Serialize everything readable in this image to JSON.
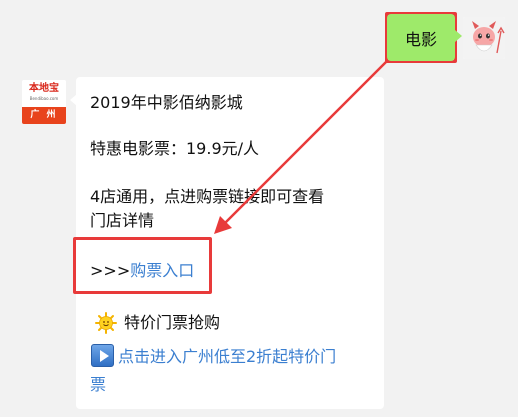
{
  "outgoing": {
    "text": "电影"
  },
  "brand_avatar": {
    "name": "本地宝",
    "sub": "Bendibao.com",
    "city": "广 州"
  },
  "incoming": {
    "line1": "2019年中影佰纳影城",
    "line2": "特惠电影票：19.9元/人",
    "line3": "4店通用，点进购票链接即可查看",
    "line4": "门店详情",
    "link_prefix": ">>>",
    "link_text": "购票入口",
    "promo_title": "特价门票抢购",
    "promo_link_1": "点击进入广州低至2折起特价门",
    "promo_link_2": "票"
  },
  "icons": {
    "sun": "sun-emoji-icon",
    "play": "play-button-icon",
    "user_avatar": "devil-character-icon"
  },
  "colors": {
    "chat_bg": "#f2f2f2",
    "outgoing_bubble": "#9eea6a",
    "link": "#3b7fd0",
    "annotation": "#e83a3a",
    "brand": "#e8431c"
  }
}
